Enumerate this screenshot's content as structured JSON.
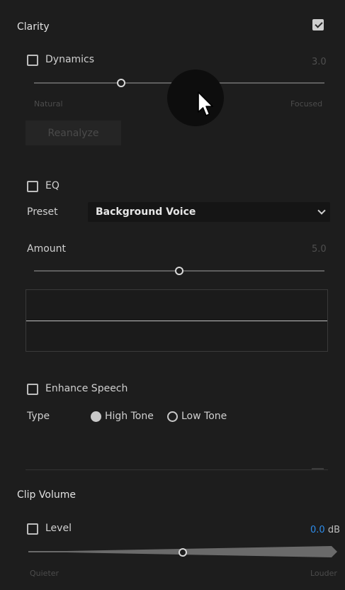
{
  "clarity": {
    "title": "Clarity",
    "dynamics": {
      "label": "Dynamics",
      "value": "3.0",
      "min_label": "Natural",
      "max_label": "Focused",
      "level": 0.3
    },
    "reanalyze_label": "Reanalyze",
    "eq": {
      "label": "EQ",
      "preset_label": "Preset",
      "preset_value": "Background Voice",
      "amount_label": "Amount",
      "amount_value": "5.0",
      "amount_level": 0.5
    },
    "enhance_speech": {
      "label": "Enhance Speech",
      "type_label": "Type",
      "high_tone": "High Tone",
      "low_tone": "Low Tone"
    }
  },
  "clip_volume": {
    "title": "Clip Volume",
    "level_label": "Level",
    "level_value": "0.0",
    "level_unit": "dB",
    "quieter_label": "Quieter",
    "louder_label": "Louder",
    "level_position": 0.5
  },
  "colors": {
    "accent_blue": "#2d8ceb",
    "panel_bg": "#1d1d1d"
  },
  "icons": [
    "checkbox-checked-icon",
    "checkbox-icon",
    "chevron-down-icon",
    "radio-selected-icon",
    "radio-unselected-icon",
    "mouse-cursor-icon"
  ]
}
